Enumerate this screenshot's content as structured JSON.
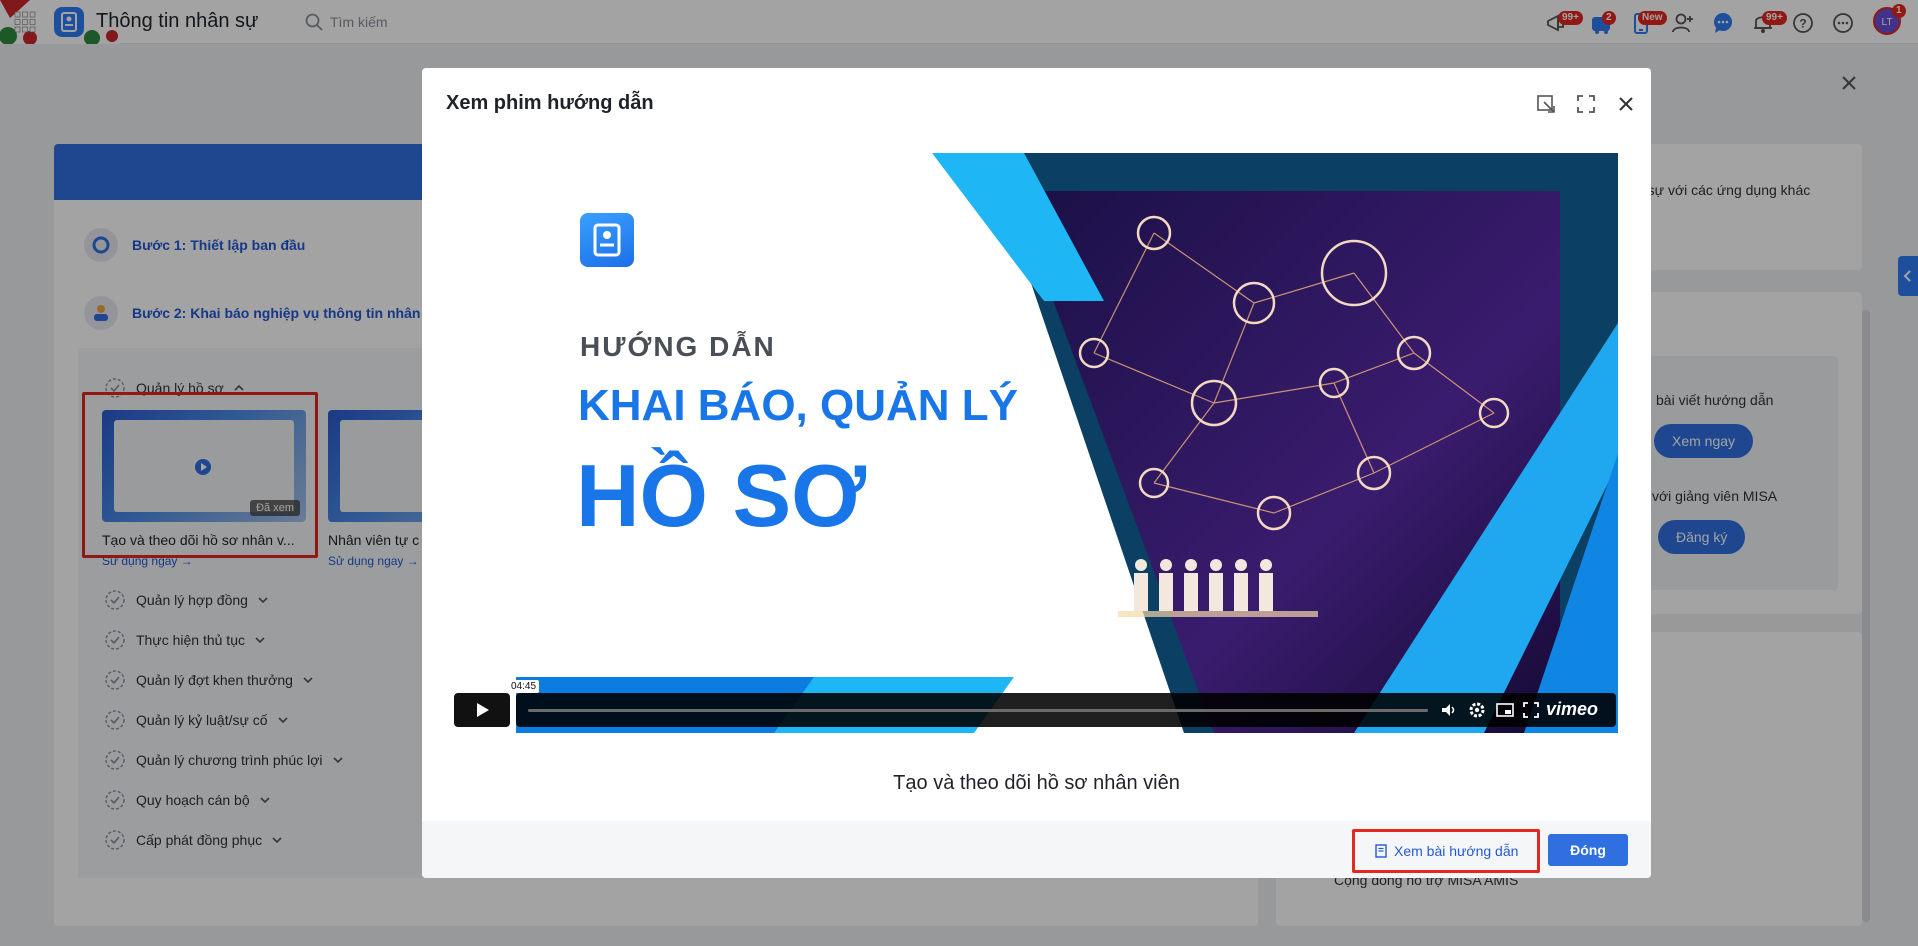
{
  "app": {
    "title": "Thông tin nhân sự"
  },
  "search": {
    "placeholder": "Tìm kiếm"
  },
  "topbar": {
    "badges": {
      "announcements": "99+",
      "cart": "2",
      "mobile": "New",
      "notifications": "99+",
      "avatar": "1"
    }
  },
  "guide": {
    "steps": [
      {
        "label": "Bước 1: Thiết lập ban đầu"
      },
      {
        "label": "Bước 2: Khai báo nghiệp vụ thông tin nhân"
      }
    ],
    "group_open": "Quản lý hồ sơ",
    "videos": [
      {
        "title": "Tạo và theo dõi hồ sơ nhân v...",
        "badge": "Đã xem",
        "action": "Sử dụng ngay →"
      },
      {
        "title": "Nhân viên tự c",
        "action": "Sử dụng ngay →"
      }
    ],
    "groups": [
      "Quản lý hợp đồng",
      "Thực hiện thủ tục",
      "Quản lý đợt khen thưởng",
      "Quản lý kỷ luật/sự cố",
      "Quản lý chương trình phúc lợi",
      "Quy hoạch cán bộ",
      "Cấp phát đồng phục"
    ]
  },
  "right": {
    "integration_text": "n sự với các ứng dụng khác",
    "article_text": "bài viết hướng dẫn",
    "article_btn": "Xem ngay",
    "trainer_text": "với giảng viên MISA",
    "trainer_btn": "Đăng ký",
    "community_text": "Cộng đồng hỗ trợ MISA AMIS"
  },
  "modal": {
    "title": "Xem phim hướng dẫn",
    "video": {
      "line1": "HƯỚNG DẪN",
      "line2": "KHAI BÁO, QUẢN LÝ",
      "line3": "HỒ SƠ",
      "time": "04:45",
      "brand": "vimeo"
    },
    "caption": "Tạo và theo dõi hồ sơ nhân viên",
    "footer": {
      "guide_btn": "Xem bài hướng dẫn",
      "close_btn": "Đóng"
    }
  },
  "colors": {
    "primary": "#2f6fe0",
    "highlight": "#e5271f",
    "video_blue": "#1976e8"
  }
}
